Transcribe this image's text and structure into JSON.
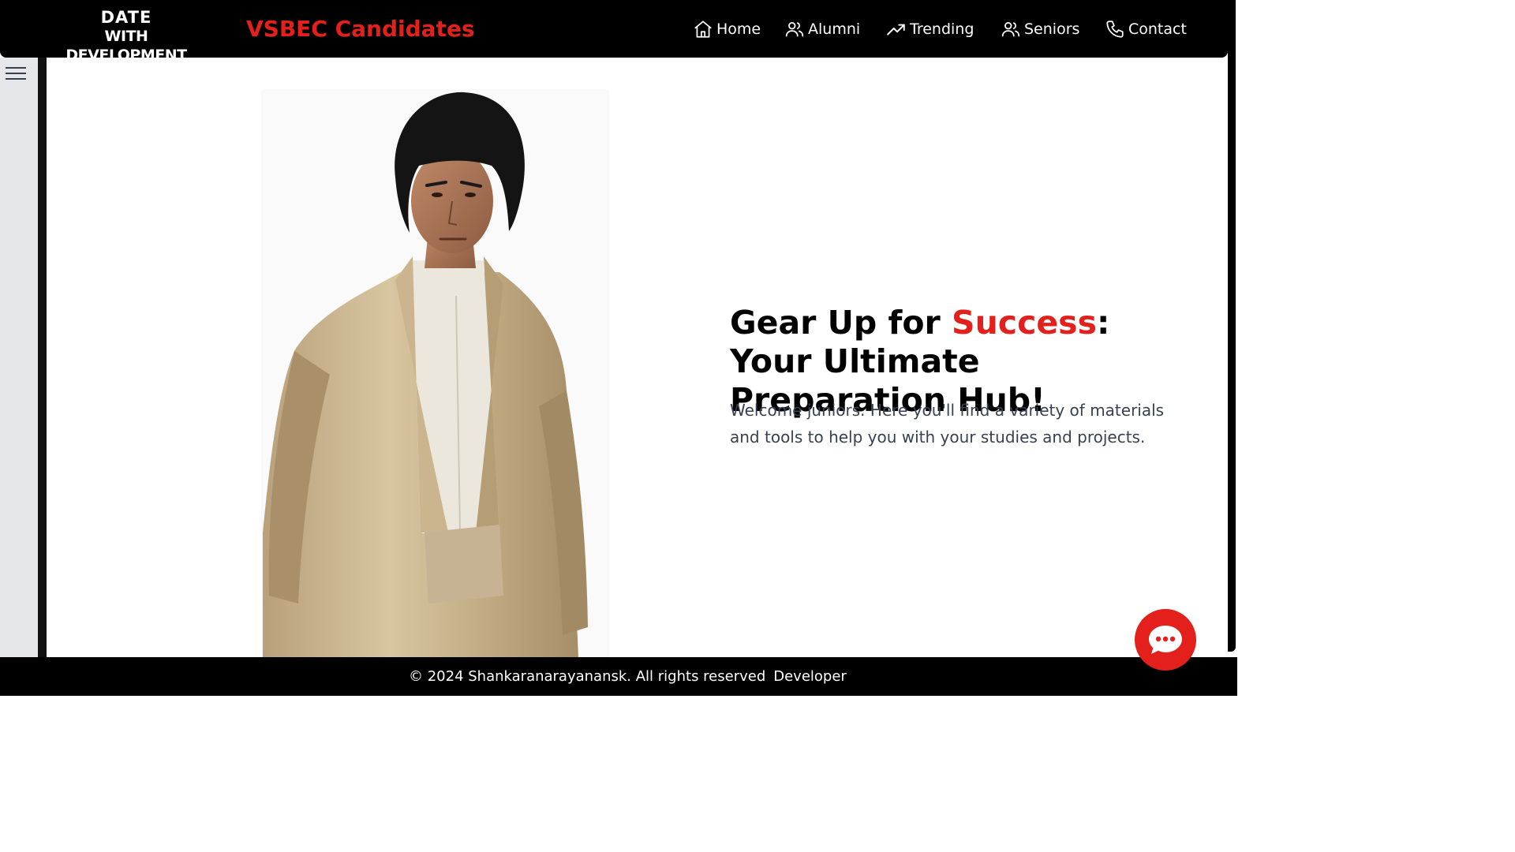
{
  "header": {
    "logo_line1": "DATE",
    "logo_line2": "WITH DEVELOPMENT",
    "brand": "VSBEC Candidates",
    "nav": [
      {
        "label": "Home",
        "icon": "home-icon"
      },
      {
        "label": "Alumni",
        "icon": "users-icon"
      },
      {
        "label": "Trending",
        "icon": "trending-up-icon"
      },
      {
        "label": "Seniors",
        "icon": "users-icon"
      },
      {
        "label": "Contact",
        "icon": "phone-icon"
      }
    ]
  },
  "sidebar": {
    "menu_icon": "hamburger-menu-icon"
  },
  "hero": {
    "title_part1": "Gear Up for ",
    "title_accent": "Success",
    "title_part2": ": Your Ultimate Preparation Hub!",
    "description": "Welcome juniors. Here you'll find a variety of materials and tools to help you with your studies and projects."
  },
  "footer": {
    "copyright": "© 2024 Shankaranarayanansk. All rights reserved",
    "developer_link": "Developer"
  },
  "chat": {
    "icon": "chat-bubble-icon"
  },
  "colors": {
    "accent": "#e3201b",
    "header_bg": "#000000",
    "sidebar_bg": "#e5e7eb"
  }
}
